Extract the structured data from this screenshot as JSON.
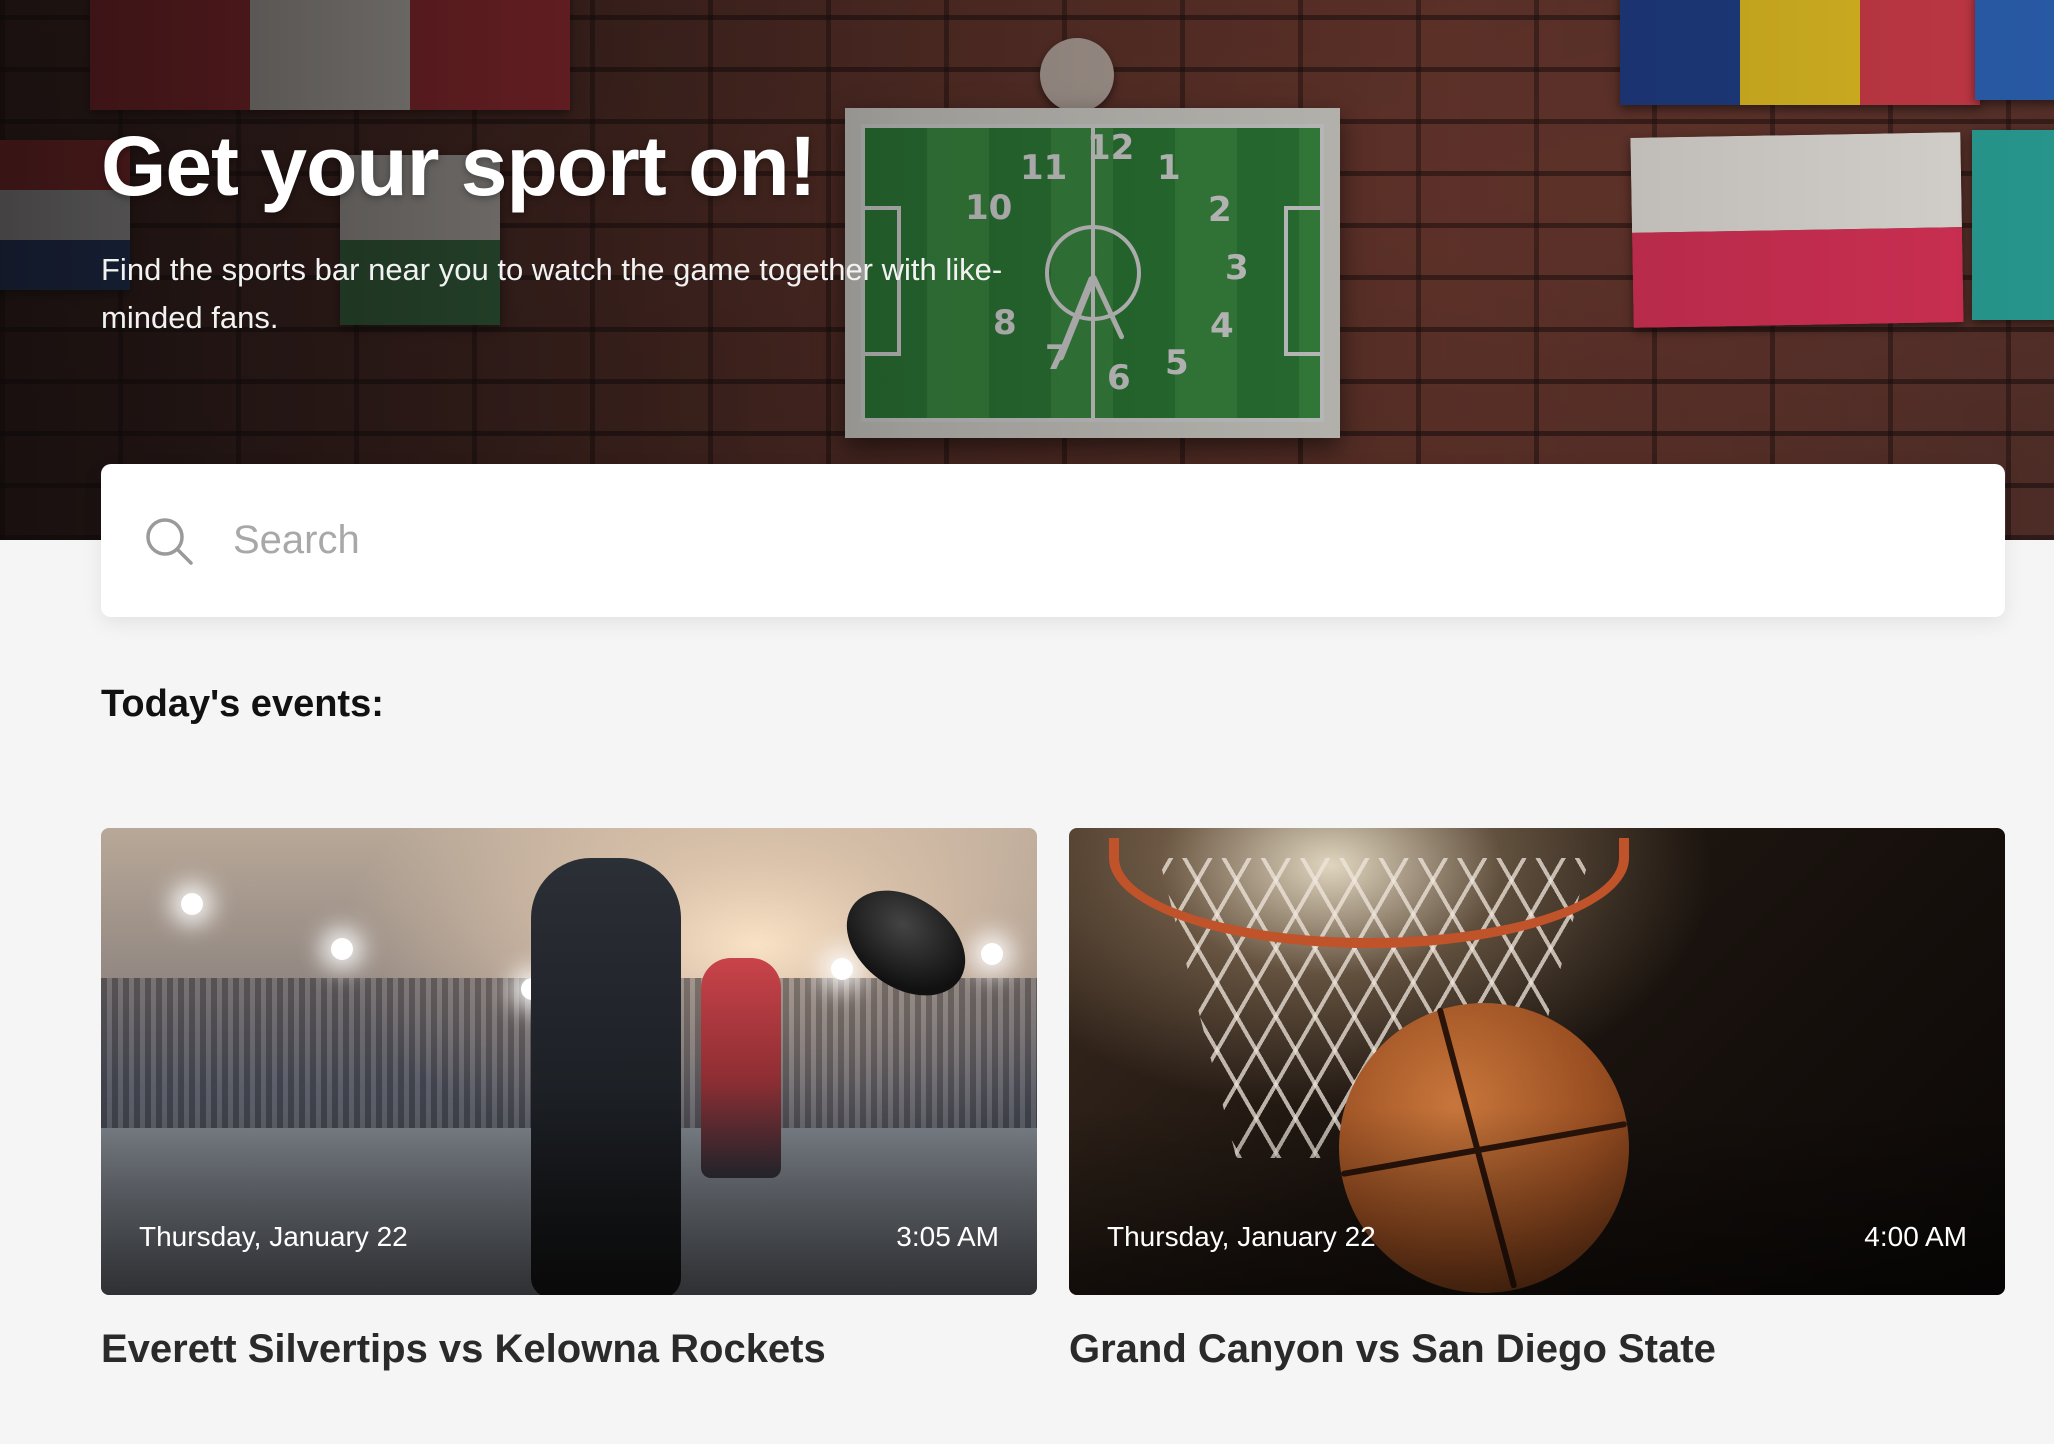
{
  "hero": {
    "title": "Get your sport on!",
    "subtitle": "Find the sports bar near you to watch the game together with like-minded fans.",
    "clock_numbers": [
      "12",
      "1",
      "2",
      "3",
      "4",
      "5",
      "6",
      "7",
      "8",
      "10",
      "11"
    ]
  },
  "search": {
    "placeholder": "Search",
    "icon": "search-icon"
  },
  "events_section": {
    "title": "Today's events:"
  },
  "events": [
    {
      "title": "Everett Silvertips vs Kelowna Rockets",
      "date": "Thursday, January 22",
      "time": "3:05 AM",
      "image": "hockey-image"
    },
    {
      "title": "Grand Canyon vs San Diego State",
      "date": "Thursday, January 22",
      "time": "4:00 AM",
      "image": "basketball-image"
    }
  ],
  "colors": {
    "page_background": "#f5f5f5",
    "title_text": "#111111",
    "card_title_text": "#2a2a2a",
    "search_placeholder": "#a8a8a8"
  }
}
